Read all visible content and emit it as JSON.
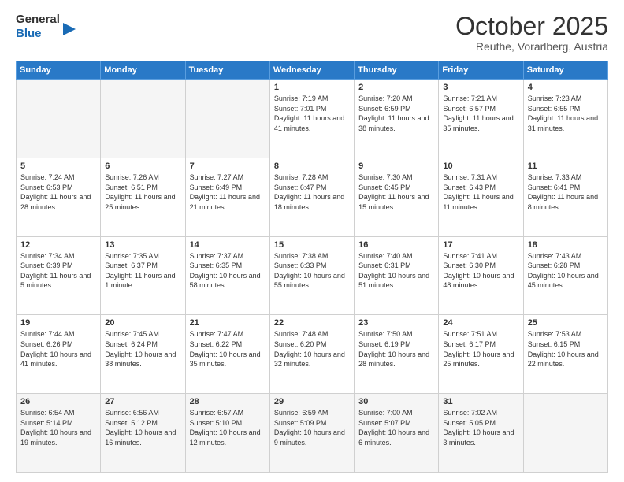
{
  "header": {
    "logo_general": "General",
    "logo_blue": "Blue",
    "month_title": "October 2025",
    "location": "Reuthe, Vorarlberg, Austria"
  },
  "days_of_week": [
    "Sunday",
    "Monday",
    "Tuesday",
    "Wednesday",
    "Thursday",
    "Friday",
    "Saturday"
  ],
  "weeks": [
    [
      {
        "day": "",
        "info": ""
      },
      {
        "day": "",
        "info": ""
      },
      {
        "day": "",
        "info": ""
      },
      {
        "day": "1",
        "info": "Sunrise: 7:19 AM\nSunset: 7:01 PM\nDaylight: 11 hours and 41 minutes."
      },
      {
        "day": "2",
        "info": "Sunrise: 7:20 AM\nSunset: 6:59 PM\nDaylight: 11 hours and 38 minutes."
      },
      {
        "day": "3",
        "info": "Sunrise: 7:21 AM\nSunset: 6:57 PM\nDaylight: 11 hours and 35 minutes."
      },
      {
        "day": "4",
        "info": "Sunrise: 7:23 AM\nSunset: 6:55 PM\nDaylight: 11 hours and 31 minutes."
      }
    ],
    [
      {
        "day": "5",
        "info": "Sunrise: 7:24 AM\nSunset: 6:53 PM\nDaylight: 11 hours and 28 minutes."
      },
      {
        "day": "6",
        "info": "Sunrise: 7:26 AM\nSunset: 6:51 PM\nDaylight: 11 hours and 25 minutes."
      },
      {
        "day": "7",
        "info": "Sunrise: 7:27 AM\nSunset: 6:49 PM\nDaylight: 11 hours and 21 minutes."
      },
      {
        "day": "8",
        "info": "Sunrise: 7:28 AM\nSunset: 6:47 PM\nDaylight: 11 hours and 18 minutes."
      },
      {
        "day": "9",
        "info": "Sunrise: 7:30 AM\nSunset: 6:45 PM\nDaylight: 11 hours and 15 minutes."
      },
      {
        "day": "10",
        "info": "Sunrise: 7:31 AM\nSunset: 6:43 PM\nDaylight: 11 hours and 11 minutes."
      },
      {
        "day": "11",
        "info": "Sunrise: 7:33 AM\nSunset: 6:41 PM\nDaylight: 11 hours and 8 minutes."
      }
    ],
    [
      {
        "day": "12",
        "info": "Sunrise: 7:34 AM\nSunset: 6:39 PM\nDaylight: 11 hours and 5 minutes."
      },
      {
        "day": "13",
        "info": "Sunrise: 7:35 AM\nSunset: 6:37 PM\nDaylight: 11 hours and 1 minute."
      },
      {
        "day": "14",
        "info": "Sunrise: 7:37 AM\nSunset: 6:35 PM\nDaylight: 10 hours and 58 minutes."
      },
      {
        "day": "15",
        "info": "Sunrise: 7:38 AM\nSunset: 6:33 PM\nDaylight: 10 hours and 55 minutes."
      },
      {
        "day": "16",
        "info": "Sunrise: 7:40 AM\nSunset: 6:31 PM\nDaylight: 10 hours and 51 minutes."
      },
      {
        "day": "17",
        "info": "Sunrise: 7:41 AM\nSunset: 6:30 PM\nDaylight: 10 hours and 48 minutes."
      },
      {
        "day": "18",
        "info": "Sunrise: 7:43 AM\nSunset: 6:28 PM\nDaylight: 10 hours and 45 minutes."
      }
    ],
    [
      {
        "day": "19",
        "info": "Sunrise: 7:44 AM\nSunset: 6:26 PM\nDaylight: 10 hours and 41 minutes."
      },
      {
        "day": "20",
        "info": "Sunrise: 7:45 AM\nSunset: 6:24 PM\nDaylight: 10 hours and 38 minutes."
      },
      {
        "day": "21",
        "info": "Sunrise: 7:47 AM\nSunset: 6:22 PM\nDaylight: 10 hours and 35 minutes."
      },
      {
        "day": "22",
        "info": "Sunrise: 7:48 AM\nSunset: 6:20 PM\nDaylight: 10 hours and 32 minutes."
      },
      {
        "day": "23",
        "info": "Sunrise: 7:50 AM\nSunset: 6:19 PM\nDaylight: 10 hours and 28 minutes."
      },
      {
        "day": "24",
        "info": "Sunrise: 7:51 AM\nSunset: 6:17 PM\nDaylight: 10 hours and 25 minutes."
      },
      {
        "day": "25",
        "info": "Sunrise: 7:53 AM\nSunset: 6:15 PM\nDaylight: 10 hours and 22 minutes."
      }
    ],
    [
      {
        "day": "26",
        "info": "Sunrise: 6:54 AM\nSunset: 5:14 PM\nDaylight: 10 hours and 19 minutes."
      },
      {
        "day": "27",
        "info": "Sunrise: 6:56 AM\nSunset: 5:12 PM\nDaylight: 10 hours and 16 minutes."
      },
      {
        "day": "28",
        "info": "Sunrise: 6:57 AM\nSunset: 5:10 PM\nDaylight: 10 hours and 12 minutes."
      },
      {
        "day": "29",
        "info": "Sunrise: 6:59 AM\nSunset: 5:09 PM\nDaylight: 10 hours and 9 minutes."
      },
      {
        "day": "30",
        "info": "Sunrise: 7:00 AM\nSunset: 5:07 PM\nDaylight: 10 hours and 6 minutes."
      },
      {
        "day": "31",
        "info": "Sunrise: 7:02 AM\nSunset: 5:05 PM\nDaylight: 10 hours and 3 minutes."
      },
      {
        "day": "",
        "info": ""
      }
    ]
  ]
}
